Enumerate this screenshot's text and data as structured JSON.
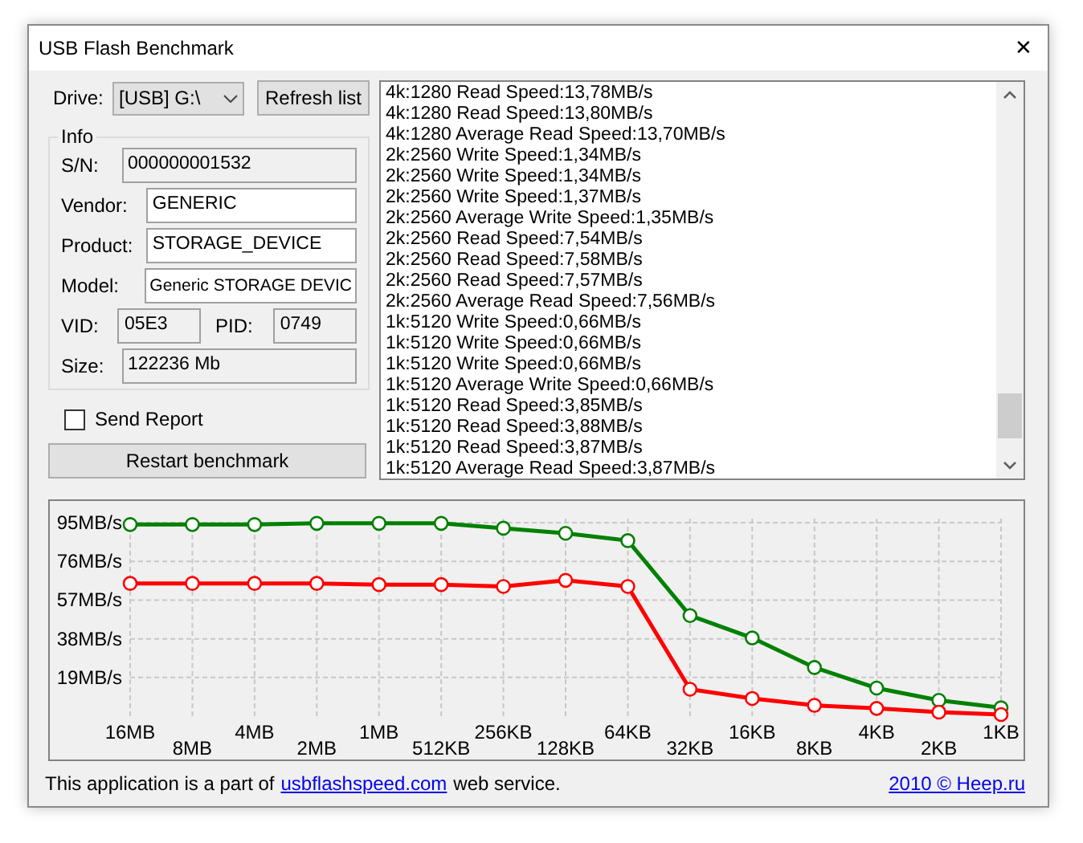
{
  "window": {
    "title": "USB Flash Benchmark",
    "close": "✕"
  },
  "drive": {
    "label": "Drive:",
    "value": "[USB] G:\\",
    "refresh": "Refresh list"
  },
  "info": {
    "title": "Info",
    "fields": [
      {
        "label": "S/N:",
        "value": "000000001532",
        "readonly": true
      },
      {
        "label": "Vendor:",
        "value": "GENERIC",
        "readonly": false
      },
      {
        "label": "Product:",
        "value": "STORAGE_DEVICE",
        "readonly": false
      },
      {
        "label": "Model:",
        "value": "Generic STORAGE DEVIC",
        "readonly": false
      }
    ],
    "vid": {
      "label": "VID:",
      "value": "05E3"
    },
    "pid": {
      "label": "PID:",
      "value": "0749"
    },
    "size": {
      "label": "Size:",
      "value": "122236 Mb"
    }
  },
  "send_report": {
    "label": "Send Report",
    "checked": false
  },
  "restart": "Restart benchmark",
  "log": [
    "4k:1280 Read Speed:13,78MB/s",
    "4k:1280 Read Speed:13,80MB/s",
    "4k:1280 Average Read Speed:13,70MB/s",
    "2k:2560 Write Speed:1,34MB/s",
    "2k:2560 Write Speed:1,34MB/s",
    "2k:2560 Write Speed:1,37MB/s",
    "2k:2560 Average Write Speed:1,35MB/s",
    "2k:2560 Read Speed:7,54MB/s",
    "2k:2560 Read Speed:7,58MB/s",
    "2k:2560 Read Speed:7,57MB/s",
    "2k:2560 Average Read Speed:7,56MB/s",
    "1k:5120 Write Speed:0,66MB/s",
    "1k:5120 Write Speed:0,66MB/s",
    "1k:5120 Write Speed:0,66MB/s",
    "1k:5120 Average Write Speed:0,66MB/s",
    "1k:5120 Read Speed:3,85MB/s",
    "1k:5120 Read Speed:3,88MB/s",
    "1k:5120 Read Speed:3,87MB/s",
    "1k:5120 Average Read Speed:3,87MB/s"
  ],
  "chart": {
    "chart_data": {
      "type": "line",
      "grid": true,
      "categories": [
        "16MB",
        "8MB",
        "4MB",
        "2MB",
        "1MB",
        "512KB",
        "256KB",
        "128KB",
        "64KB",
        "32KB",
        "16KB",
        "8KB",
        "4KB",
        "2KB",
        "1KB"
      ],
      "series": [
        {
          "color": "#008000",
          "marker": "circle",
          "values": [
            94.1,
            94.1,
            94.1,
            94.7,
            94.7,
            94.7,
            92.3,
            89.8,
            86.2,
            49.4,
            38.4,
            23.9,
            13.8,
            7.8,
            4.1
          ]
        },
        {
          "color": "#ff0000",
          "marker": "circle",
          "values": [
            65.2,
            65.2,
            65.2,
            65.2,
            64.6,
            64.6,
            63.7,
            66.7,
            63.7,
            13.2,
            8.7,
            5.3,
            3.8,
            2.0,
            0.8
          ]
        }
      ],
      "ylim": [
        0,
        97
      ],
      "yticks": [
        {
          "value": 19,
          "label": "19MB/s"
        },
        {
          "value": 38,
          "label": "38MB/s"
        },
        {
          "value": 57,
          "label": "57MB/s"
        },
        {
          "value": 76,
          "label": "76MB/s"
        },
        {
          "value": 95,
          "label": "95MB/s"
        }
      ]
    }
  },
  "footer": {
    "before": "This application is a part of",
    "link": "usbflashspeed.com",
    "after": "web service.",
    "credit": "2010 © Heep.ru"
  }
}
